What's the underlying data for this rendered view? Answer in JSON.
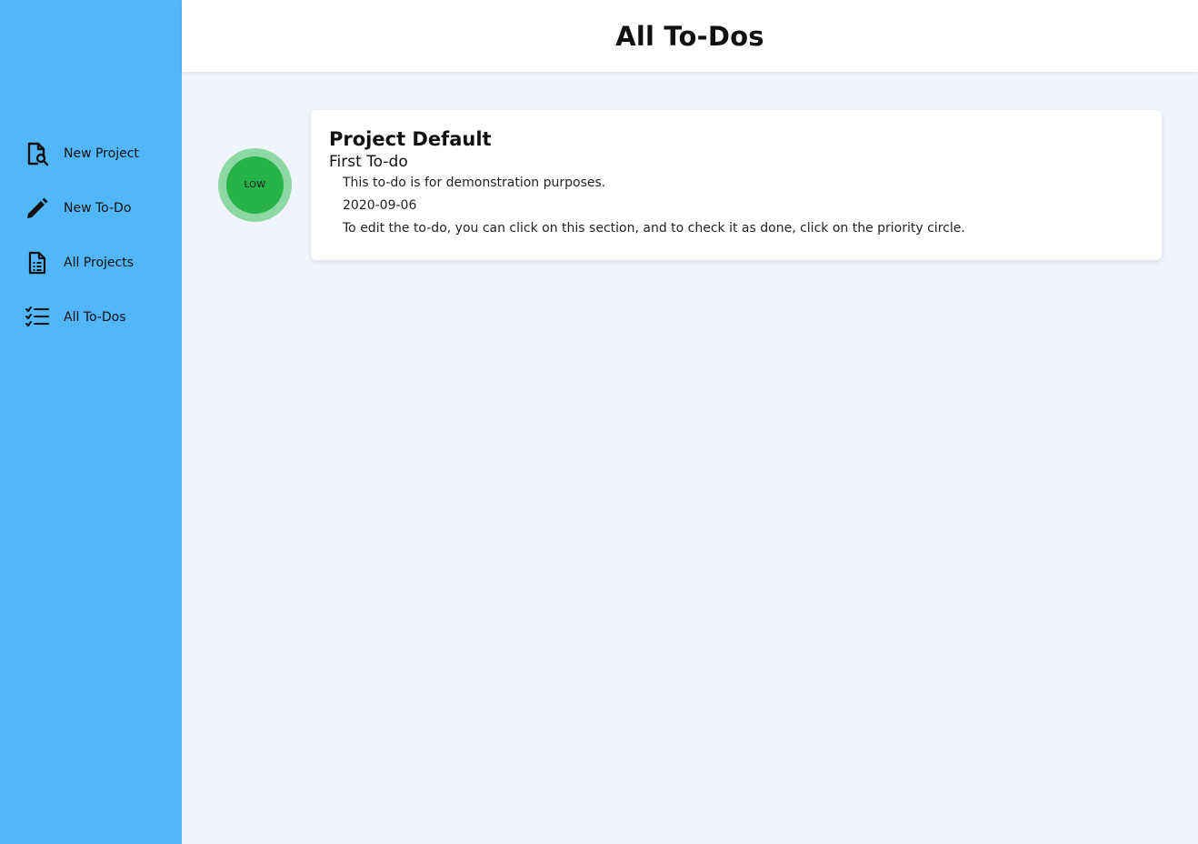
{
  "header": {
    "title": "All To-Dos"
  },
  "sidebar": {
    "background": "#52b6fa",
    "items": [
      {
        "label": "New Project",
        "icon": "new-project-icon"
      },
      {
        "label": "New To-Do",
        "icon": "pencil-icon"
      },
      {
        "label": "All Projects",
        "icon": "document-list-icon"
      },
      {
        "label": "All To-Dos",
        "icon": "checklist-icon"
      }
    ]
  },
  "todos": [
    {
      "priority": "LOW",
      "priority_color": "#27b34a",
      "project": "Project Default",
      "title": "First To-do",
      "description": "This to-do is for demonstration purposes.",
      "date": "2020-09-06",
      "notes": "To edit the to-do, you can click on this section, and to check it as done, click on the priority circle."
    }
  ]
}
